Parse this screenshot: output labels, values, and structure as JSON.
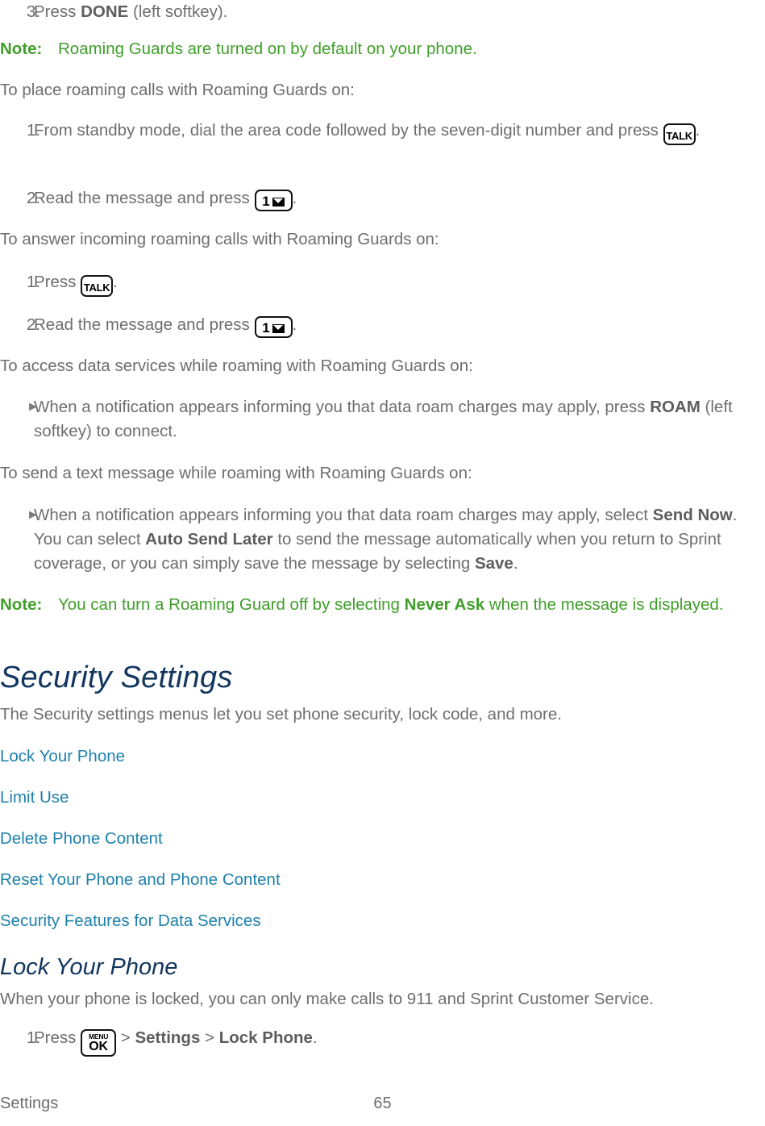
{
  "document": {
    "title": "Sprint Phone User Guide - Settings",
    "colors": {
      "body_text": "#6e6e6e",
      "note_green": "#3f9e29",
      "heading_navy": "#12365e",
      "link_blue": "#1f81ac",
      "key_border": "#111111"
    }
  },
  "blocks": {
    "step3": {
      "marker": "3.",
      "text_before": "Press ",
      "bold": "DONE",
      "text_after": " (left softkey)."
    },
    "note1": {
      "label": "Note:",
      "text": "Roaming Guards are turned on by default on your phone."
    },
    "intro_place_calls": "To place roaming calls with Roaming Guards on:",
    "place_step1": {
      "marker": "1.",
      "text_before": "From standby mode, dial the area code followed by the seven-digit number and press ",
      "key": "talk-key",
      "text_after": "."
    },
    "place_step2": {
      "marker": "2.",
      "text_before": "Read the message and press ",
      "key": "one-message-key",
      "text_after": "."
    },
    "intro_answer_calls": "To answer incoming roaming calls with Roaming Guards on:",
    "answer_step1": {
      "marker": "1.",
      "text_before": "Press ",
      "key": "talk-key",
      "text_after": "."
    },
    "answer_step2": {
      "marker": "2.",
      "text_before": "Read the message and press ",
      "key": "one-message-key",
      "text_after": "."
    },
    "intro_data_services": "To access data services while roaming with Roaming Guards on:",
    "data_bullet": {
      "marker": "►",
      "text_before": "When a notification appears informing you that data roam charges may apply, press ",
      "bold": "ROAM",
      "text_after": " (left softkey) to connect."
    },
    "intro_text_message": "To send a text message while roaming with Roaming Guards on:",
    "text_bullet": {
      "marker": "►",
      "part1": "When a notification appears informing you that data roam charges may apply, select ",
      "bold1": "Send Now",
      "part2": ". You can select ",
      "bold2": "Auto Send Later",
      "part3": " to send the message automatically when you return to Sprint coverage, or you can simply save the message by selecting ",
      "bold3": "Save",
      "part4": "."
    },
    "note2": {
      "label": "Note:",
      "part1": "You can turn a Roaming Guard off by selecting ",
      "bold1": "Never Ask",
      "part2": " when the message is displayed."
    }
  },
  "security_section": {
    "heading": "Security Settings",
    "intro": "The Security settings menus let you set phone security, lock code, and more.",
    "links": [
      "Lock Your Phone",
      "Limit Use",
      "Delete Phone Content",
      "Reset Your Phone and Phone Content",
      "Security Features for Data Services"
    ]
  },
  "lock_section": {
    "heading": "Lock Your Phone",
    "intro": "When your phone is locked, you can only make calls to 911 and Sprint Customer Service.",
    "step1": {
      "marker": "1.",
      "text_before": "Press ",
      "key": "menu-ok-key",
      "sep1": " > ",
      "bold1": "Settings",
      "sep2": " > ",
      "bold2": "Lock Phone",
      "text_after": "."
    }
  },
  "keys": {
    "talk": {
      "label": "TALK"
    },
    "one_message": {
      "digit": "1",
      "icon": "envelope-icon"
    },
    "menu_ok": {
      "top": "MENU",
      "bottom": "OK"
    }
  },
  "footer": {
    "left": "Settings",
    "page_number": "65"
  }
}
